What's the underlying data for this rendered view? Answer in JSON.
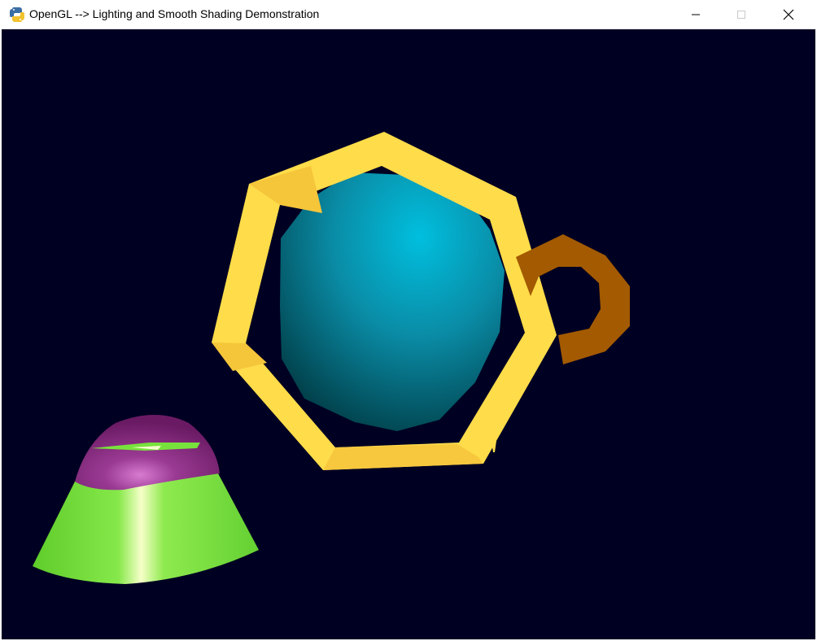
{
  "window": {
    "title": "OpenGL --> Lighting and Smooth Shading Demonstration",
    "app_icon": "python-icon",
    "controls": {
      "minimize": "minimize-icon",
      "maximize": "maximize-icon",
      "close": "close-icon"
    }
  },
  "scene": {
    "background": "#000022",
    "objects": [
      {
        "name": "sphere",
        "color": "#00A8C8"
      },
      {
        "name": "octagon-ring",
        "color": "#FFD84A"
      },
      {
        "name": "handle",
        "color": "#A35A00"
      },
      {
        "name": "cone-cap",
        "color": "#7E2178"
      },
      {
        "name": "cone-body",
        "color": "#78E23C"
      }
    ]
  }
}
